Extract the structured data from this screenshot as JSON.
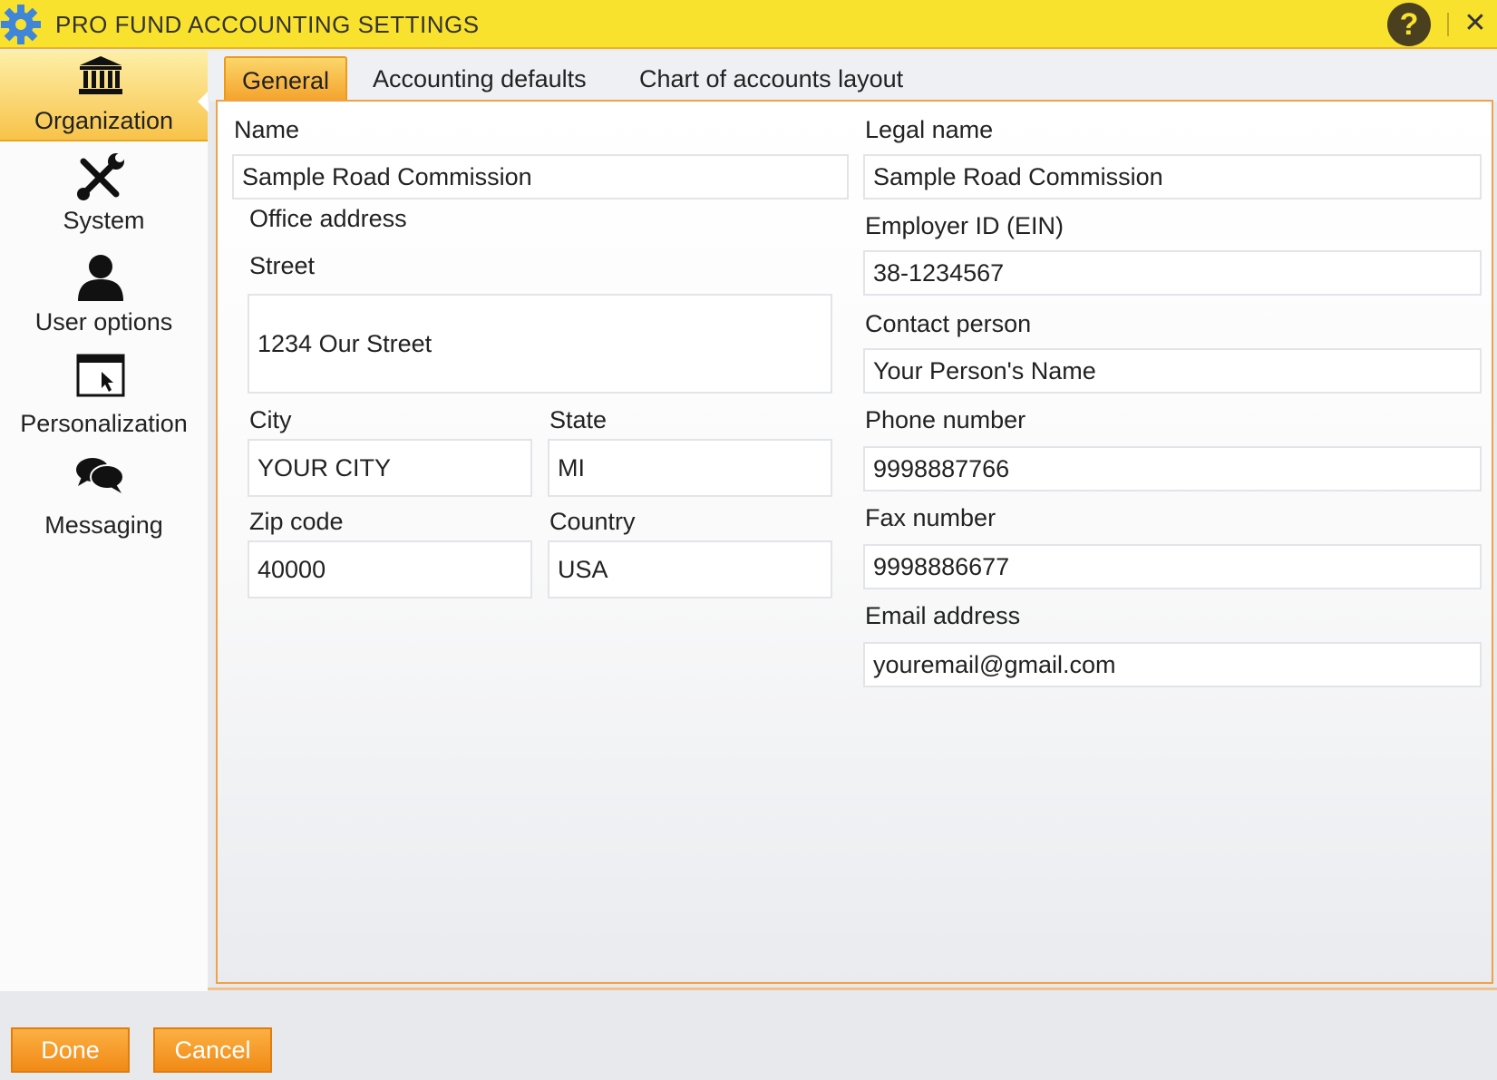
{
  "window": {
    "title": "PRO FUND ACCOUNTING SETTINGS",
    "help_label": "?",
    "close_label": "✕"
  },
  "sidebar": {
    "items": [
      {
        "label": "Organization",
        "icon": "bank-icon",
        "active": true
      },
      {
        "label": "System",
        "icon": "tools-icon"
      },
      {
        "label": "User options",
        "icon": "user-icon"
      },
      {
        "label": "Personalization",
        "icon": "window-cursor-icon"
      },
      {
        "label": "Messaging",
        "icon": "chat-bubbles-icon"
      }
    ]
  },
  "tabs": [
    {
      "label": "General",
      "active": true
    },
    {
      "label": "Accounting defaults"
    },
    {
      "label": "Chart of accounts layout"
    }
  ],
  "form": {
    "name": {
      "label": "Name",
      "value": "Sample Road Commission"
    },
    "legal_name": {
      "label": "Legal name",
      "value": "Sample Road Commission"
    },
    "office_address_label": "Office address",
    "street": {
      "label": "Street",
      "value": "1234 Our Street"
    },
    "city": {
      "label": "City",
      "value": "YOUR CITY"
    },
    "state": {
      "label": "State",
      "value": "MI"
    },
    "zip": {
      "label": "Zip code",
      "value": "40000"
    },
    "country": {
      "label": "Country",
      "value": "USA"
    },
    "ein": {
      "label": "Employer ID (EIN)",
      "value": "38-1234567"
    },
    "contact": {
      "label": "Contact person",
      "value": "Your Person's Name"
    },
    "phone": {
      "label": "Phone number",
      "value": "9998887766"
    },
    "fax": {
      "label": "Fax number",
      "value": "9998886677"
    },
    "email": {
      "label": "Email address",
      "value": "youremail@gmail.com"
    }
  },
  "buttons": {
    "done": "Done",
    "cancel": "Cancel"
  },
  "colors": {
    "title_bar": "#f9e22e",
    "accent": "#f4a22b",
    "button": "#f18a16"
  }
}
